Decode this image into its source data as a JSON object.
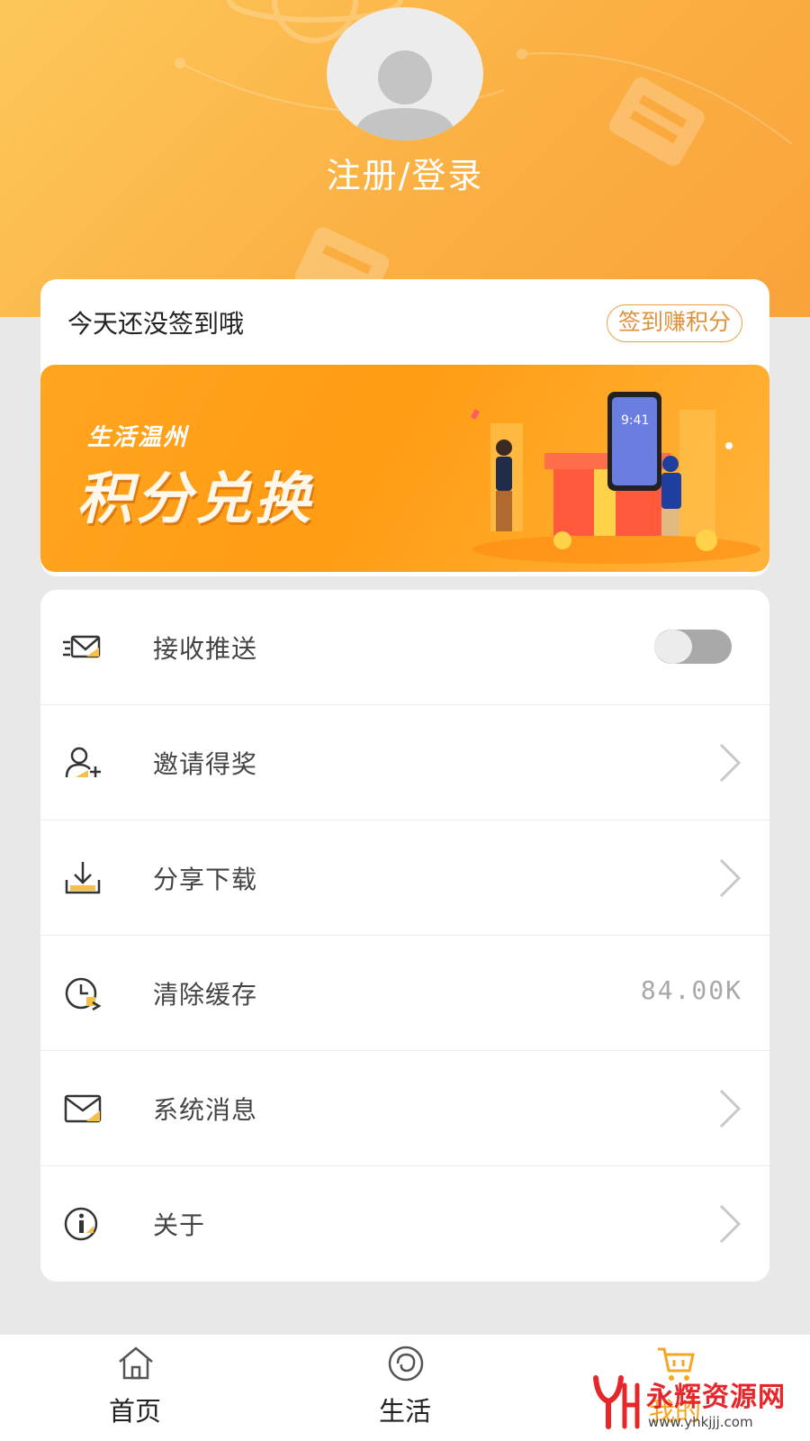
{
  "profile": {
    "login_text": "注册/登录"
  },
  "signin": {
    "status_text": "今天还没签到哦",
    "button_label": "签到赚积分"
  },
  "banner": {
    "subtitle": "生活温州",
    "title": "积分兑换"
  },
  "menu": {
    "items": [
      {
        "label": "接收推送",
        "icon": "envelope-fast-icon",
        "control": "toggle",
        "toggle_on": false
      },
      {
        "label": "邀请得奖",
        "icon": "add-user-icon",
        "control": "chevron"
      },
      {
        "label": "分享下载",
        "icon": "download-icon",
        "control": "chevron"
      },
      {
        "label": "清除缓存",
        "icon": "clock-icon",
        "control": "value",
        "value": "84.00K"
      },
      {
        "label": "系统消息",
        "icon": "mail-icon",
        "control": "chevron"
      },
      {
        "label": "关于",
        "icon": "info-icon",
        "control": "chevron"
      }
    ]
  },
  "tabbar": {
    "tabs": [
      {
        "label": "首页",
        "icon": "home-icon",
        "active": false
      },
      {
        "label": "生活",
        "icon": "life-swirl-icon",
        "active": false
      },
      {
        "label": "我的",
        "icon": "cart-icon",
        "active": true
      }
    ]
  },
  "watermark": {
    "text": "永辉资源网",
    "url": "www.yhkjjj.com"
  },
  "colors": {
    "accent": "#f5a623",
    "header_gradient_start": "#fcc75a",
    "header_gradient_end": "#f9a33a",
    "banner_orange": "#ff9c14"
  }
}
